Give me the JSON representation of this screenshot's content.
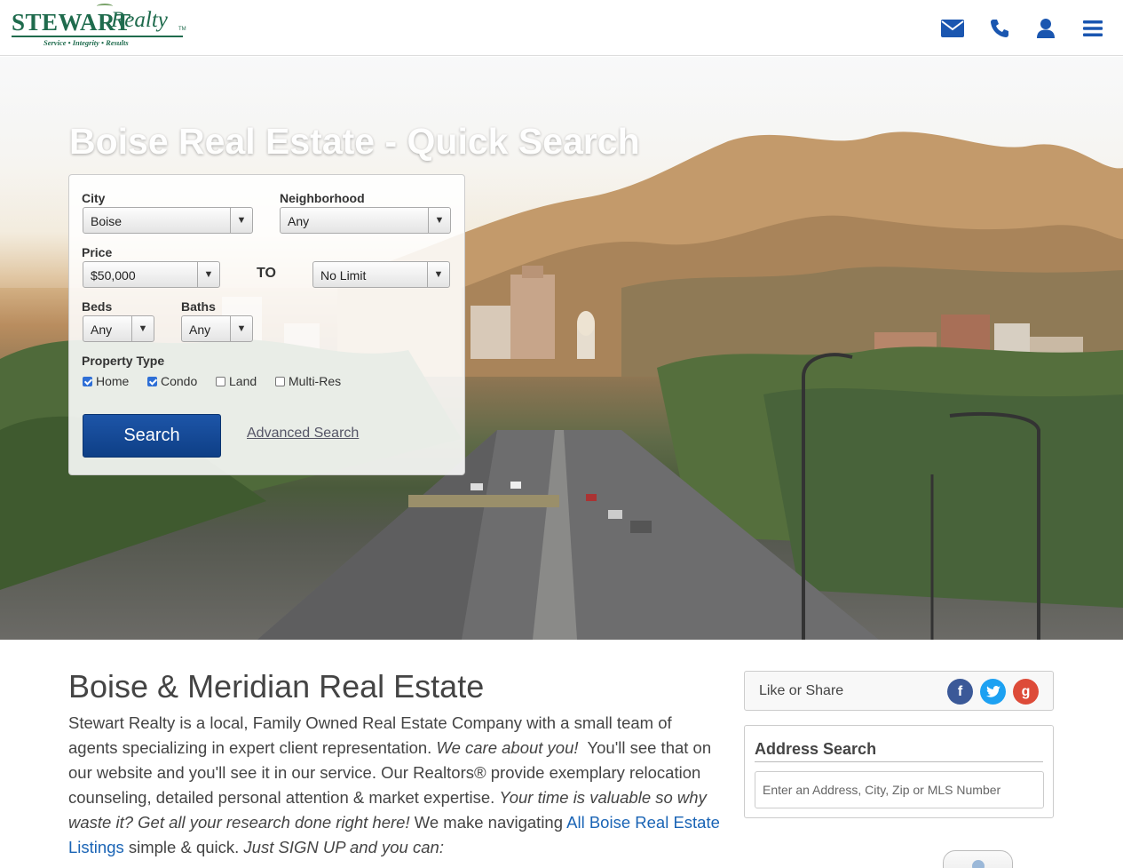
{
  "header": {
    "logo": {
      "main": "STEWART",
      "script": "Realty",
      "tm": "TM",
      "tagline": "Service • Integrity • Results"
    },
    "icons": [
      "envelope-icon",
      "phone-icon",
      "user-icon",
      "menu-icon"
    ],
    "brand_color": "#1f6b4d",
    "icon_color": "#1a56b0"
  },
  "hero": {
    "title": "Boise Real Estate - Quick Search",
    "form": {
      "city_label": "City",
      "city_value": "Boise",
      "neighborhood_label": "Neighborhood",
      "neighborhood_value": "Any",
      "price_label": "Price",
      "price_min": "$50,000",
      "to_label": "TO",
      "price_max": "No Limit",
      "beds_label": "Beds",
      "beds_value": "Any",
      "baths_label": "Baths",
      "baths_value": "Any",
      "property_type_label": "Property Type",
      "types": [
        {
          "label": "Home",
          "checked": true
        },
        {
          "label": "Condo",
          "checked": true
        },
        {
          "label": "Land",
          "checked": false
        },
        {
          "label": "Multi-Res",
          "checked": false
        }
      ],
      "search_label": "Search",
      "advanced_label": "Advanced Search"
    }
  },
  "main": {
    "title": "Boise & Meridian Real Estate",
    "para": {
      "t1": "Stewart Realty is a local, Family Owned Real Estate Company with a small team of agents specializing in expert client representation. ",
      "i1": "We care about you!",
      "t2": "  You'll see that on our website and you'll see it in our service. Our Realtors® provide exemplary relocation counseling, detailed personal attention & market expertise. ",
      "i2": "Your time is valuable so why waste it? Get all your research done right here!",
      "t3": " We make navigating ",
      "link": "All Boise Real Estate Listings",
      "t4": " simple & quick. ",
      "i3": "Just SIGN UP and you can:"
    }
  },
  "sidebar": {
    "share_label": "Like or Share",
    "social": [
      {
        "glyph": "f",
        "color": "#3b5998"
      },
      {
        "glyph": "t",
        "color": "#1da1f2"
      },
      {
        "glyph": "g",
        "color": "#dd4b39"
      }
    ],
    "address_title": "Address Search",
    "address_placeholder": "Enter an Address, City, Zip or MLS Number"
  }
}
